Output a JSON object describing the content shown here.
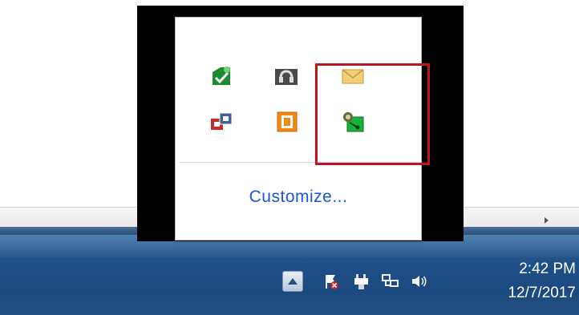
{
  "popup": {
    "customize_label": "Customize...",
    "icons": [
      {
        "name": "sync-green-icon"
      },
      {
        "name": "headset-icon"
      },
      {
        "name": "envelope-icon"
      },
      {
        "name": "network-share-icon"
      },
      {
        "name": "office-icon"
      },
      {
        "name": "vpn-connection-icon"
      }
    ]
  },
  "taskbar": {
    "clock": {
      "time": "2:42 PM",
      "date": "12/7/2017"
    },
    "tray_icons": [
      "show-hidden-icons",
      "action-center-flag-icon",
      "power-plug-icon",
      "network-icon",
      "volume-icon"
    ]
  },
  "colors": {
    "highlight": "#c0151d",
    "link": "#1a56d6",
    "taskbar": "#1d4f86"
  }
}
